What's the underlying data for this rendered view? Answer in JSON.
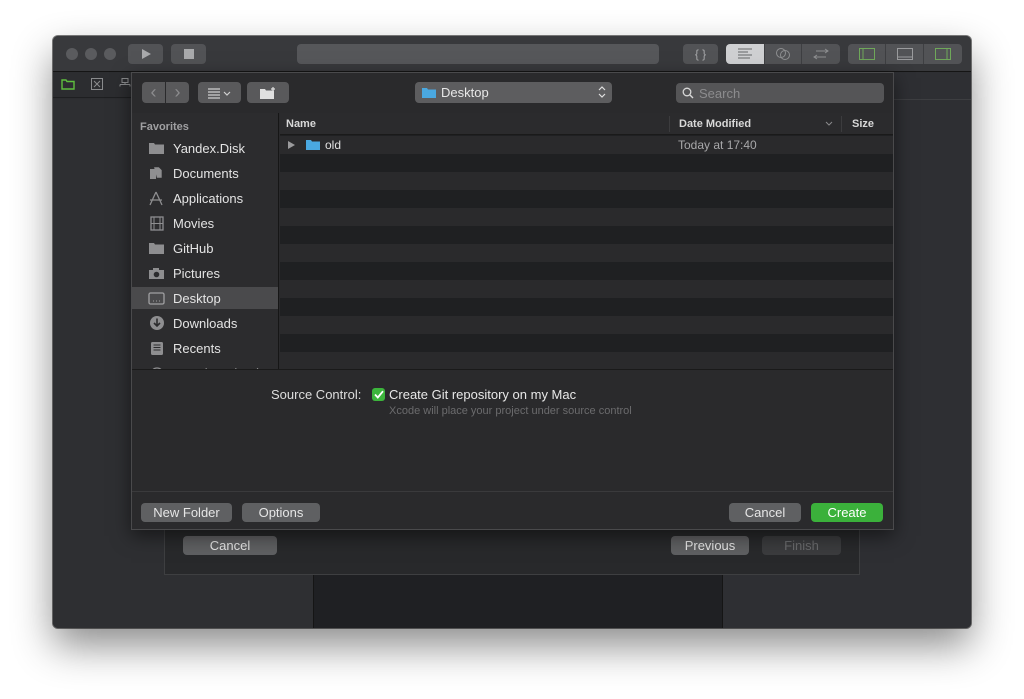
{
  "xcode": {
    "toolbar": {
      "run_icon": "play-icon",
      "stop_icon": "stop-icon",
      "library_label": "{ }",
      "editor_modes": [
        "standard-editor-icon",
        "assistant-editor-icon",
        "version-editor-icon"
      ],
      "panels": [
        "navigator-panel-icon",
        "debug-panel-icon",
        "inspector-panel-icon"
      ]
    },
    "navigator_icons": [
      "folder-icon",
      "source-control-icon",
      "hierarchy-icon"
    ],
    "assistant": {
      "cancel_label": "Cancel",
      "previous_label": "Previous",
      "finish_label": "Finish"
    }
  },
  "save_panel": {
    "toolbar": {
      "back_icon": "‹",
      "forward_icon": "›",
      "view_icon": "≡",
      "new_folder_icon": "new-folder-icon",
      "location": "Desktop",
      "search_placeholder": "Search"
    },
    "sidebar": {
      "section": "Favorites",
      "items": [
        {
          "label": "Yandex.Disk",
          "icon": "folder-icon"
        },
        {
          "label": "Documents",
          "icon": "documents-icon"
        },
        {
          "label": "Applications",
          "icon": "applications-icon"
        },
        {
          "label": "Movies",
          "icon": "movies-icon"
        },
        {
          "label": "GitHub",
          "icon": "folder-icon"
        },
        {
          "label": "Pictures",
          "icon": "camera-icon"
        },
        {
          "label": "Desktop",
          "icon": "desktop-icon",
          "selected": true
        },
        {
          "label": "Downloads",
          "icon": "download-icon"
        },
        {
          "label": "Recents",
          "icon": "recents-icon"
        },
        {
          "label": "Creative Cloud",
          "icon": "cloud-icon"
        }
      ]
    },
    "filelist": {
      "columns": {
        "name": "Name",
        "date": "Date Modified",
        "size": "Size"
      },
      "rows": [
        {
          "name": "old",
          "date": "Today at 17:40",
          "type": "folder"
        }
      ]
    },
    "source_control": {
      "label": "Source Control:",
      "checkbox_label": "Create Git repository on my Mac",
      "checked": true,
      "hint": "Xcode will place your project under source control"
    },
    "footer": {
      "new_folder_label": "New Folder",
      "options_label": "Options",
      "cancel_label": "Cancel",
      "create_label": "Create"
    }
  },
  "colors": {
    "accent_green": "#3bb13b",
    "folder_blue": "#4aa8e0",
    "nav_green": "#5fbf3f"
  }
}
